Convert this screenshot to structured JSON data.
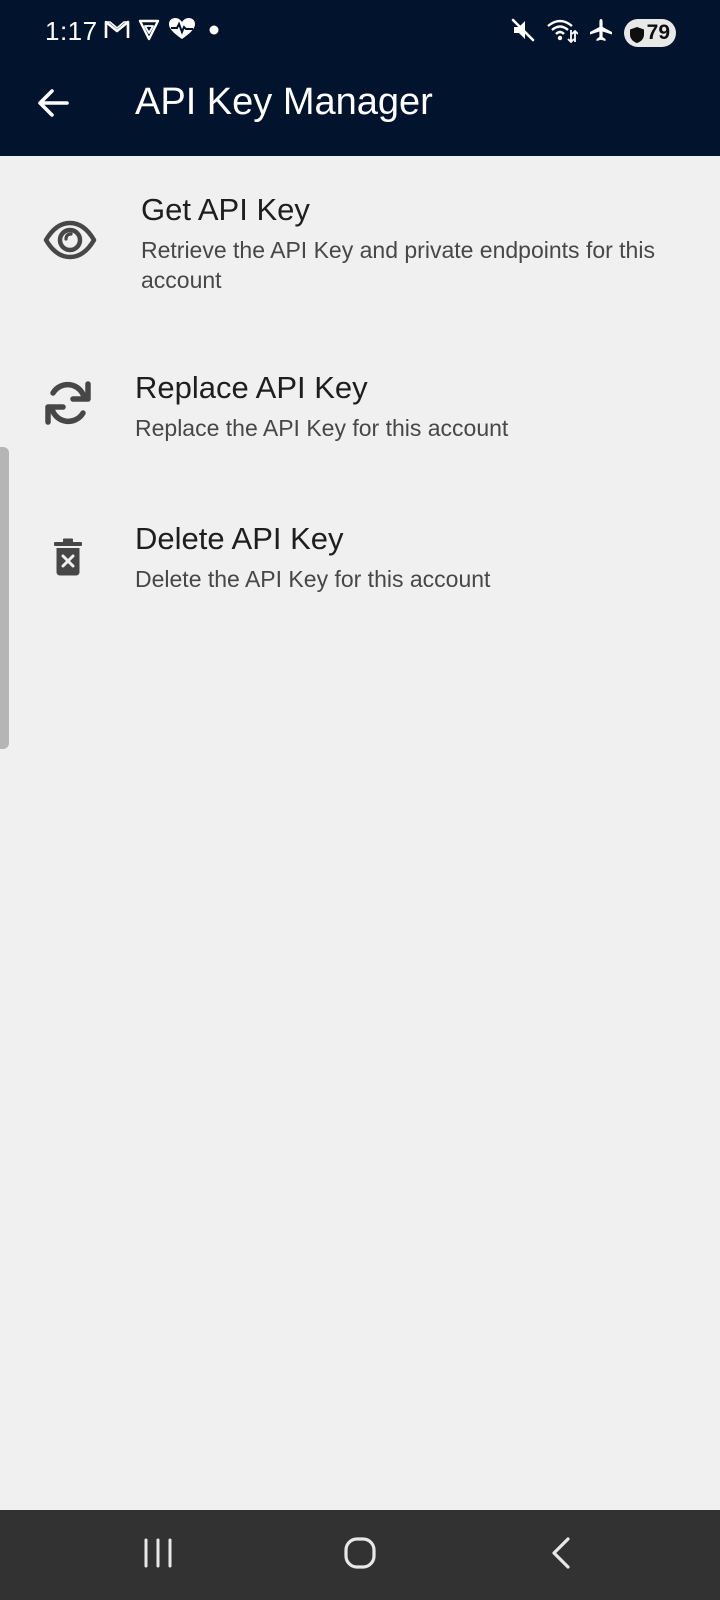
{
  "status_bar": {
    "time": "1:17",
    "left_icons": [
      "gmail-icon",
      "vpn-icon",
      "health-icon",
      "dot-icon"
    ],
    "right_icons": [
      "mute-icon",
      "wifi-icon",
      "airplane-icon"
    ],
    "battery_level": "79"
  },
  "app_bar": {
    "title": "API Key Manager",
    "back_icon": "arrow-left-icon"
  },
  "menu": {
    "items": [
      {
        "title": "Get API Key",
        "subtitle": "Retrieve the API Key and private endpoints for this account",
        "icon": "eye-icon"
      },
      {
        "title": "Replace API Key",
        "subtitle": "Replace the API Key for this account",
        "icon": "refresh-icon"
      },
      {
        "title": "Delete API Key",
        "subtitle": "Delete the API Key for this account",
        "icon": "trash-icon"
      }
    ]
  },
  "nav_bar": {
    "buttons": [
      "recents-icon",
      "home-icon",
      "back-icon"
    ]
  },
  "colors": {
    "app_bar_bg": "#02132e",
    "body_bg": "#f0f0f0",
    "nav_bar_bg": "#323232",
    "icon_color": "#474747"
  }
}
